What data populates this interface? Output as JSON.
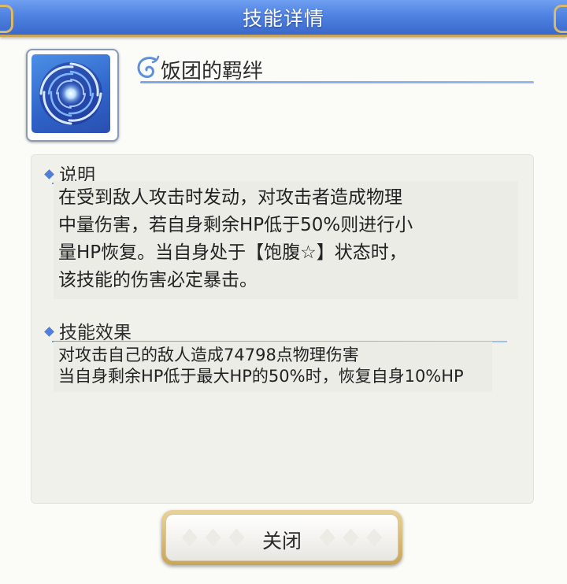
{
  "dialog": {
    "title": "技能详情",
    "close_label": "关闭"
  },
  "skill": {
    "icon": "vortex-icon",
    "name": "饭团的羁绊"
  },
  "description": {
    "heading": "说明",
    "lines": [
      "在受到敌人攻击时发动，对攻击者造成物理",
      "中量伤害，若自身剩余HP低于50%则进行小",
      "量HP恢复。当自身处于【饱腹☆】状态时，",
      "该技能的伤害必定暴击。"
    ]
  },
  "effect": {
    "heading": "技能效果",
    "lines": [
      "对攻击自己的敌人造成74798点物理伤害",
      "当自身剩余HP低于最大HP的50%时，恢复自身10%HP"
    ]
  },
  "colors": {
    "title_bar": "#4f82e2",
    "accent_line": "#6e98e0",
    "button_gold": "#c8a55a"
  }
}
